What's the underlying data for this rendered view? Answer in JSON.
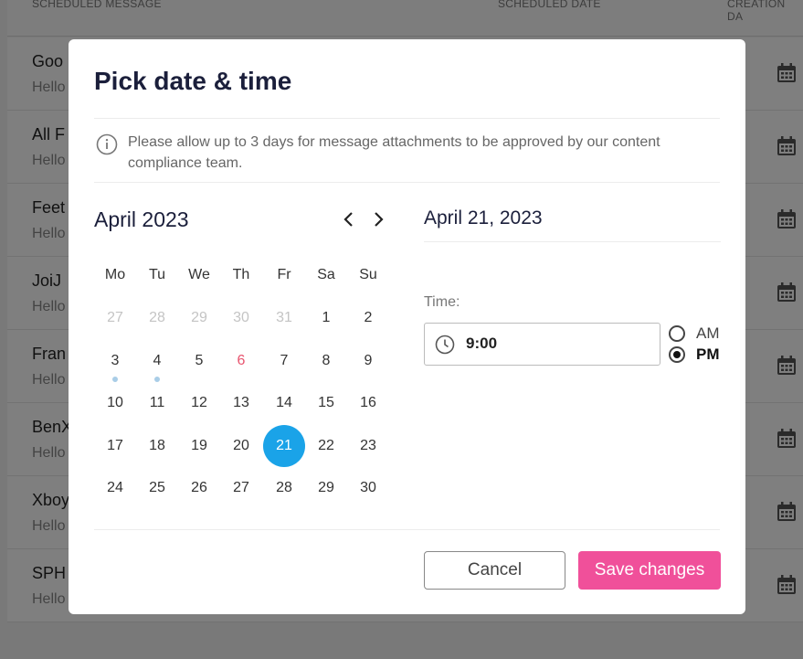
{
  "background": {
    "headers": [
      "SCHEDULED MESSAGE",
      "SCHEDULED DATE",
      "CREATION DA"
    ],
    "rows": [
      {
        "name": "Goo",
        "sub": "Hello"
      },
      {
        "name": "All F",
        "sub": "Hello"
      },
      {
        "name": "Feet",
        "sub": "Hello"
      },
      {
        "name": "JoiJ",
        "sub": "Hello"
      },
      {
        "name": "Fran",
        "sub": "Hello"
      },
      {
        "name": "BenX",
        "sub": "Hello"
      },
      {
        "name": "Xboy",
        "sub": "Hello"
      },
      {
        "name": "SPH",
        "sub": "Hello"
      }
    ],
    "row_icon": "calendar-icon"
  },
  "modal": {
    "title": "Pick date & time",
    "info": "Please allow up to 3 days for message attachments to be approved by our content compliance team.",
    "info_icon": "info-icon"
  },
  "calendar": {
    "month_label": "April 2023",
    "prev_icon": "chevron-left-icon",
    "next_icon": "chevron-right-icon",
    "weekdays": [
      "Mo",
      "Tu",
      "We",
      "Th",
      "Fr",
      "Sa",
      "Su"
    ],
    "weeks": [
      [
        {
          "d": "27",
          "m": true
        },
        {
          "d": "28",
          "m": true
        },
        {
          "d": "29",
          "m": true
        },
        {
          "d": "30",
          "m": true
        },
        {
          "d": "31",
          "m": true
        },
        {
          "d": "1"
        },
        {
          "d": "2"
        }
      ],
      [
        {
          "d": "3",
          "dot": true
        },
        {
          "d": "4",
          "dot": true
        },
        {
          "d": "5"
        },
        {
          "d": "6",
          "today": true
        },
        {
          "d": "7"
        },
        {
          "d": "8"
        },
        {
          "d": "9"
        }
      ],
      [
        {
          "d": "10"
        },
        {
          "d": "11"
        },
        {
          "d": "12"
        },
        {
          "d": "13"
        },
        {
          "d": "14"
        },
        {
          "d": "15"
        },
        {
          "d": "16"
        }
      ],
      [
        {
          "d": "17"
        },
        {
          "d": "18"
        },
        {
          "d": "19"
        },
        {
          "d": "20"
        },
        {
          "d": "21",
          "sel": true
        },
        {
          "d": "22"
        },
        {
          "d": "23"
        }
      ],
      [
        {
          "d": "24"
        },
        {
          "d": "25"
        },
        {
          "d": "26"
        },
        {
          "d": "27"
        },
        {
          "d": "28"
        },
        {
          "d": "29"
        },
        {
          "d": "30"
        }
      ]
    ],
    "colors": {
      "selected": "#1aa3e8",
      "today": "#e8546e",
      "event_dot": "#a9cde7"
    }
  },
  "time": {
    "selected_date": "April 21, 2023",
    "label": "Time:",
    "value": "9:00",
    "clock_icon": "clock-icon",
    "am_label": "AM",
    "pm_label": "PM",
    "period": "PM"
  },
  "actions": {
    "cancel_label": "Cancel",
    "save_label": "Save changes",
    "save_color": "#f0509a"
  }
}
